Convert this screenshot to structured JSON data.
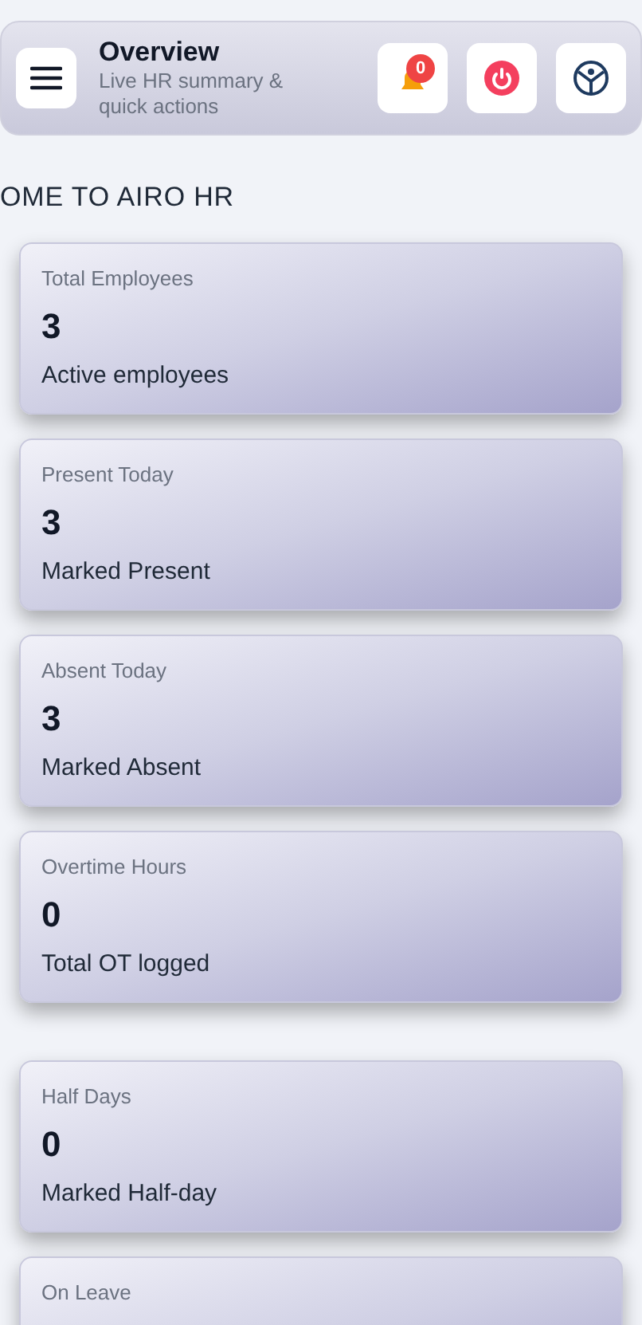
{
  "header": {
    "title": "Overview",
    "subtitle": "Live HR summary & quick actions",
    "notification_count": "0"
  },
  "welcome": "OME TO AIRO HR",
  "cards": [
    {
      "label": "Total Employees",
      "value": "3",
      "caption": "Active employees"
    },
    {
      "label": "Present Today",
      "value": "3",
      "caption": "Marked Present"
    },
    {
      "label": "Absent Today",
      "value": "3",
      "caption": "Marked Absent"
    },
    {
      "label": "Overtime Hours",
      "value": "0",
      "caption": "Total OT logged"
    },
    {
      "label": "Half Days",
      "value": "0",
      "caption": "Marked Half-day"
    },
    {
      "label": "On Leave"
    }
  ]
}
